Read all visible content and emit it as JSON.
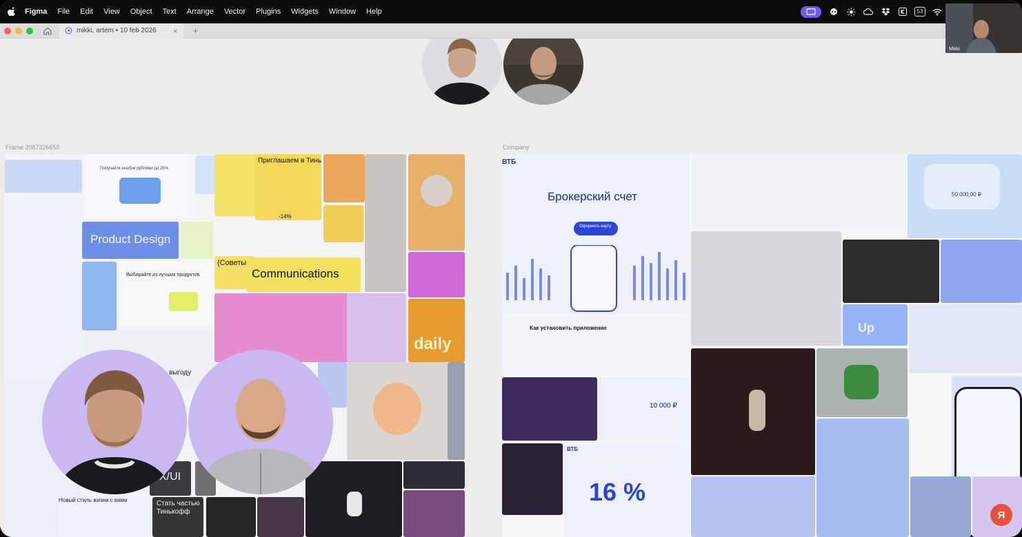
{
  "menubar": {
    "app_name": "Figma",
    "items": [
      "File",
      "Edit",
      "View",
      "Object",
      "Text",
      "Arrange",
      "Vector",
      "Plugins",
      "Widgets",
      "Window",
      "Help"
    ],
    "battery": "53"
  },
  "tabbar": {
    "tab_title": "mikki, artem • 10 feb 2026",
    "close_glyph": "×",
    "plus_glyph": "+"
  },
  "canvas": {
    "left_frame_label": "Frame 2087326650",
    "right_frame_label": "Company",
    "left_board": {
      "texts": {
        "promo_1": "Получайте кешбэк рублями до 25%",
        "invite_title": "Приглашаем в Тинькофф",
        "product_design": "Product Design",
        "choose_products": "Выбирайте из лучших продуктов",
        "advice": "(Советы)",
        "communications": "Communications",
        "daily": "daily",
        "ux_ui": "X/UI",
        "new_style": "Новый стиль жизни с вами",
        "become_part": "Стать частью Тинькофф",
        "discount": "-14%",
        "vygodu": "выгоду"
      }
    },
    "right_board": {
      "texts": {
        "vtb_logo": "ВТБ",
        "broker_title": "Брокерский счет",
        "open_card": "Оформить карту",
        "install_app": "Как установить приложение",
        "amount_small": "10 000 ₽",
        "percent": "16 %",
        "card_amount": "50 000,00 ₽",
        "up": "Up"
      }
    }
  },
  "camera": {
    "name": "Mikki"
  },
  "yandex_badge": "Я"
}
